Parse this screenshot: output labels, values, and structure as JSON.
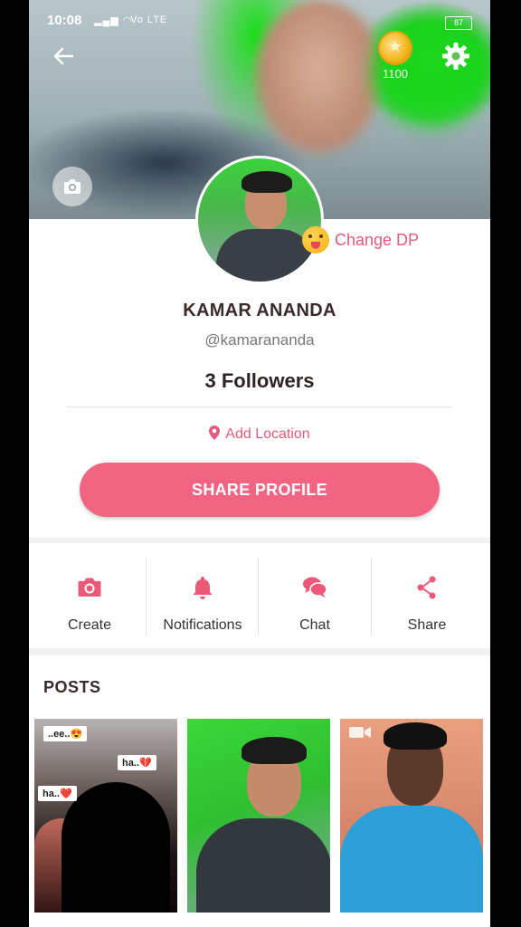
{
  "status_bar": {
    "time": "10:08",
    "signal": "Vo LTE",
    "battery": "87"
  },
  "header": {
    "coin_count": "1100",
    "icons": [
      "back-arrow-icon",
      "coin-icon",
      "gear-icon",
      "camera-icon"
    ]
  },
  "profile": {
    "change_dp_label": "Change DP",
    "name": "KAMAR ANANDA",
    "handle": "@kamarananda",
    "followers": "3 Followers",
    "location_label": "Add Location",
    "share_button": "SHARE PROFILE"
  },
  "actions": [
    {
      "label": "Create",
      "icon": "camera-icon"
    },
    {
      "label": "Notifications",
      "icon": "bell-icon"
    },
    {
      "label": "Chat",
      "icon": "chat-bubbles-icon"
    },
    {
      "label": "Share",
      "icon": "share-icon"
    }
  ],
  "posts": {
    "title": "POSTS",
    "items": [
      {
        "tags": [
          "..ee..😍",
          "ha..💔",
          "ha..❤️"
        ]
      },
      {
        "tags": []
      },
      {
        "tags": []
      }
    ]
  },
  "colors": {
    "accent": "#f16583",
    "accent_text": "#e35b7d"
  }
}
